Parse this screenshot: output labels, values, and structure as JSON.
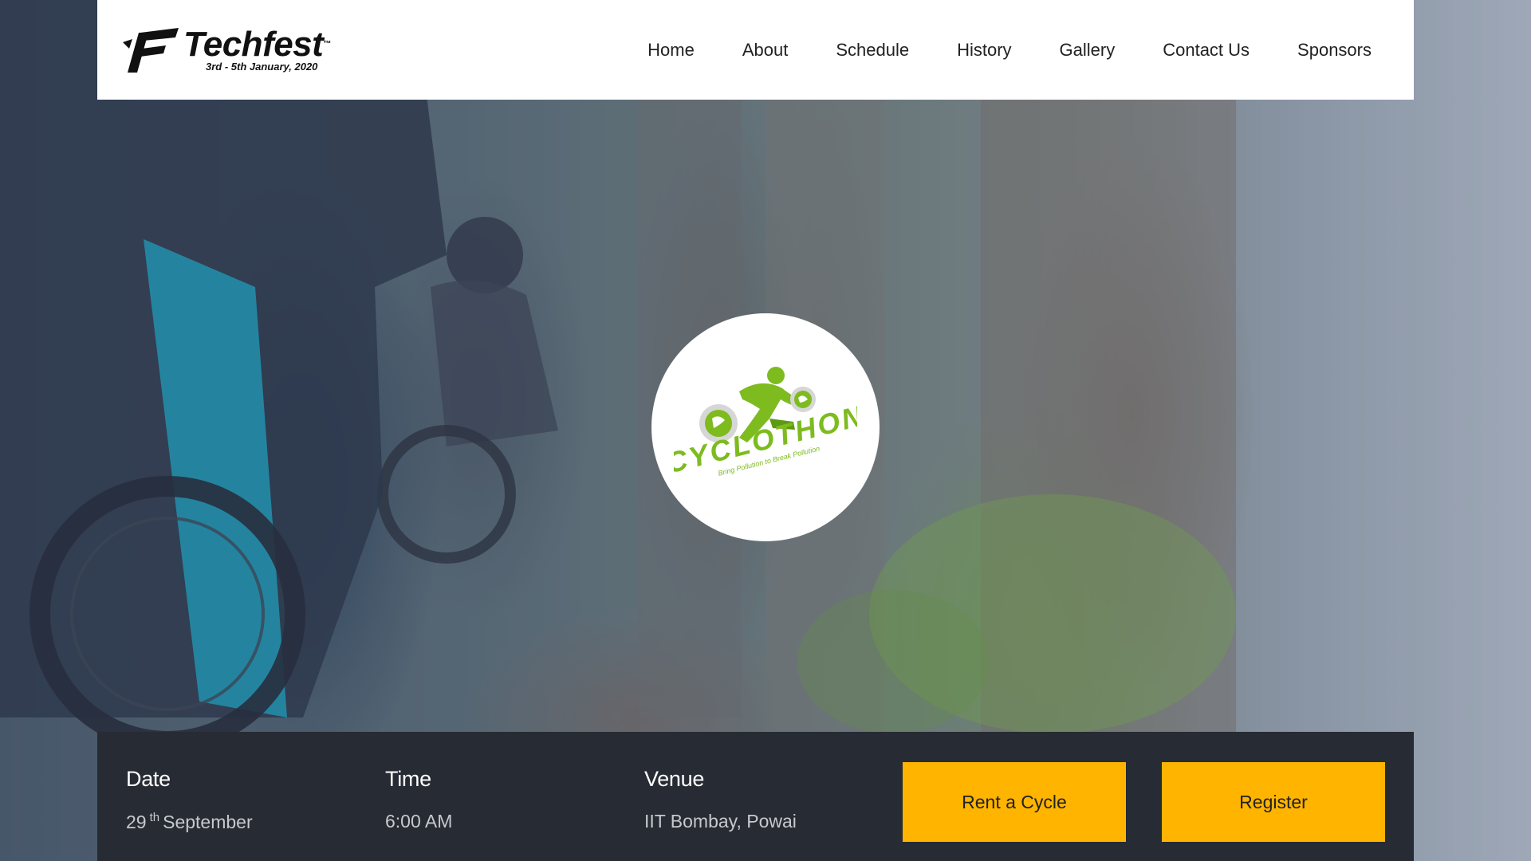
{
  "header": {
    "logo": {
      "title": "Techfest",
      "trademark": "™",
      "dates": "3rd - 5th January, 2020",
      "icon": "techfest-logo-icon"
    },
    "nav": [
      {
        "label": "Home"
      },
      {
        "label": "About"
      },
      {
        "label": "Schedule"
      },
      {
        "label": "History"
      },
      {
        "label": "Gallery"
      },
      {
        "label": "Contact Us"
      },
      {
        "label": "Sponsors"
      }
    ]
  },
  "hero": {
    "badge": {
      "title": "CYCLOTHON",
      "tagline": "Bring Pollution to Break Pollution",
      "icon": "cyclist-icon"
    }
  },
  "info": {
    "date": {
      "label": "Date",
      "day": "29",
      "suffix": "th",
      "month": "September"
    },
    "time": {
      "label": "Time",
      "value": "6:00 AM"
    },
    "venue": {
      "label": "Venue",
      "value": "IIT Bombay, Powai"
    }
  },
  "actions": {
    "rent_label": "Rent a Cycle",
    "register_label": "Register"
  },
  "colors": {
    "accent": "#ffb400",
    "info_bar_bg": "#272b33",
    "badge_green": "#7dbb1f"
  }
}
